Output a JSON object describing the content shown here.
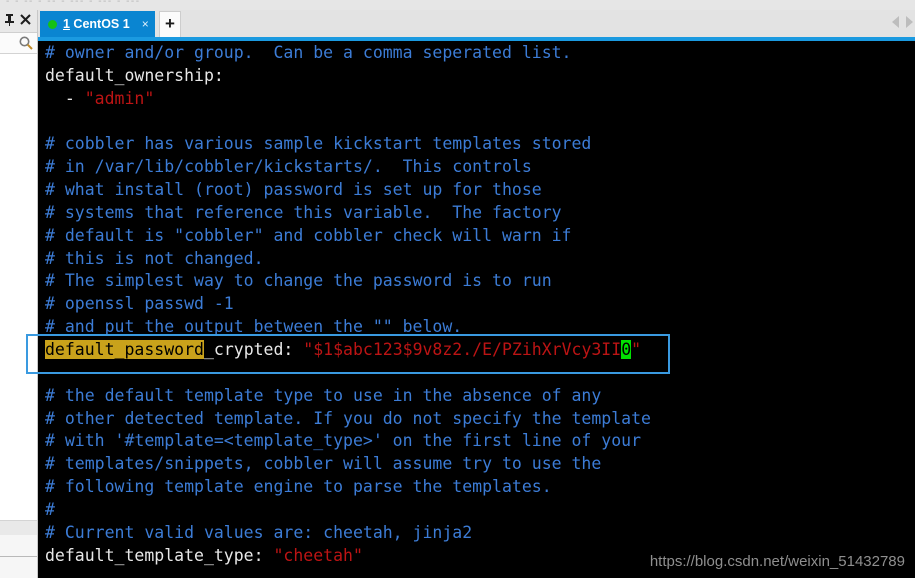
{
  "window": {
    "ghost_top_text": "- - -- -  -- - --- -   --- - ---"
  },
  "session_panel": {
    "pin_icon": "pin-icon",
    "close_icon": "close-icon",
    "search_icon": "search-icon"
  },
  "tabbar": {
    "tabs": [
      {
        "status_dot": "green",
        "index": "1",
        "name": " CentOS 1",
        "close_label": "×"
      }
    ],
    "add_tab_label": "+",
    "scroll_left_icon": "chevron-left-icon",
    "scroll_right_icon": "chevron-right-icon"
  },
  "terminal": {
    "lines": [
      {
        "segments": [
          {
            "text": "# owner and/or group.  Can be a comma seperated list.",
            "cls": "cmt"
          }
        ]
      },
      {
        "segments": [
          {
            "text": "default_ownership:",
            "cls": "key"
          }
        ]
      },
      {
        "segments": [
          {
            "text": "  - ",
            "cls": "key"
          },
          {
            "text": "\"admin\"",
            "cls": "str"
          }
        ]
      },
      {
        "segments": [
          {
            "text": "",
            "cls": "key"
          }
        ]
      },
      {
        "segments": [
          {
            "text": "# cobbler has various sample kickstart templates stored",
            "cls": "cmt"
          }
        ]
      },
      {
        "segments": [
          {
            "text": "# in /var/lib/cobbler/kickstarts/.  This controls",
            "cls": "cmt"
          }
        ]
      },
      {
        "segments": [
          {
            "text": "# what install (root) password is set up for those",
            "cls": "cmt"
          }
        ]
      },
      {
        "segments": [
          {
            "text": "# systems that reference this variable.  The factory",
            "cls": "cmt"
          }
        ]
      },
      {
        "segments": [
          {
            "text": "# default is \"cobbler\" and cobbler check will warn if",
            "cls": "cmt"
          }
        ]
      },
      {
        "segments": [
          {
            "text": "# this is not changed.",
            "cls": "cmt"
          }
        ]
      },
      {
        "segments": [
          {
            "text": "# The simplest way to change the password is to run",
            "cls": "cmt"
          }
        ]
      },
      {
        "segments": [
          {
            "text": "# openssl passwd -1",
            "cls": "cmt"
          }
        ]
      },
      {
        "segments": [
          {
            "text": "# and put the output between the \"\" below.",
            "cls": "cmt"
          }
        ]
      },
      {
        "segments": [
          {
            "text": "default_password",
            "cls": "hl"
          },
          {
            "text": "_crypted: ",
            "cls": "key"
          },
          {
            "text": "\"$1$abc123$9v8z2./E/PZihXrVcy3II",
            "cls": "str"
          },
          {
            "text": "0",
            "cls": "cursor"
          },
          {
            "text": "\"",
            "cls": "str"
          }
        ]
      },
      {
        "segments": [
          {
            "text": "",
            "cls": "key"
          }
        ]
      },
      {
        "segments": [
          {
            "text": "# the default template type to use in the absence of any",
            "cls": "cmt"
          }
        ]
      },
      {
        "segments": [
          {
            "text": "# other detected template. If you do not specify the template",
            "cls": "cmt"
          }
        ]
      },
      {
        "segments": [
          {
            "text": "# with '#template=<template_type>' on the first line of your",
            "cls": "cmt"
          }
        ]
      },
      {
        "segments": [
          {
            "text": "# templates/snippets, cobbler will assume try to use the",
            "cls": "cmt"
          }
        ]
      },
      {
        "segments": [
          {
            "text": "# following template engine to parse the templates.",
            "cls": "cmt"
          }
        ]
      },
      {
        "segments": [
          {
            "text": "#",
            "cls": "cmt"
          }
        ]
      },
      {
        "segments": [
          {
            "text": "# Current valid values are: cheetah, jinja2",
            "cls": "cmt"
          }
        ]
      },
      {
        "segments": [
          {
            "text": "default_template_type: ",
            "cls": "key"
          },
          {
            "text": "\"cheetah\"",
            "cls": "str"
          }
        ]
      }
    ]
  },
  "annotation": {
    "target_line": "default_password_crypted"
  },
  "watermark": {
    "text": "https://blog.csdn.net/weixin_51432789"
  },
  "colors": {
    "tab_active": "#0a85d1",
    "tab_underline": "#1b9ae0",
    "terminal_bg": "#000000",
    "comment": "#3c7cd6",
    "string": "#bc1414",
    "highlight": "#c9a21b",
    "cursor": "#00e000",
    "annotation_border": "#3a9ae0"
  }
}
